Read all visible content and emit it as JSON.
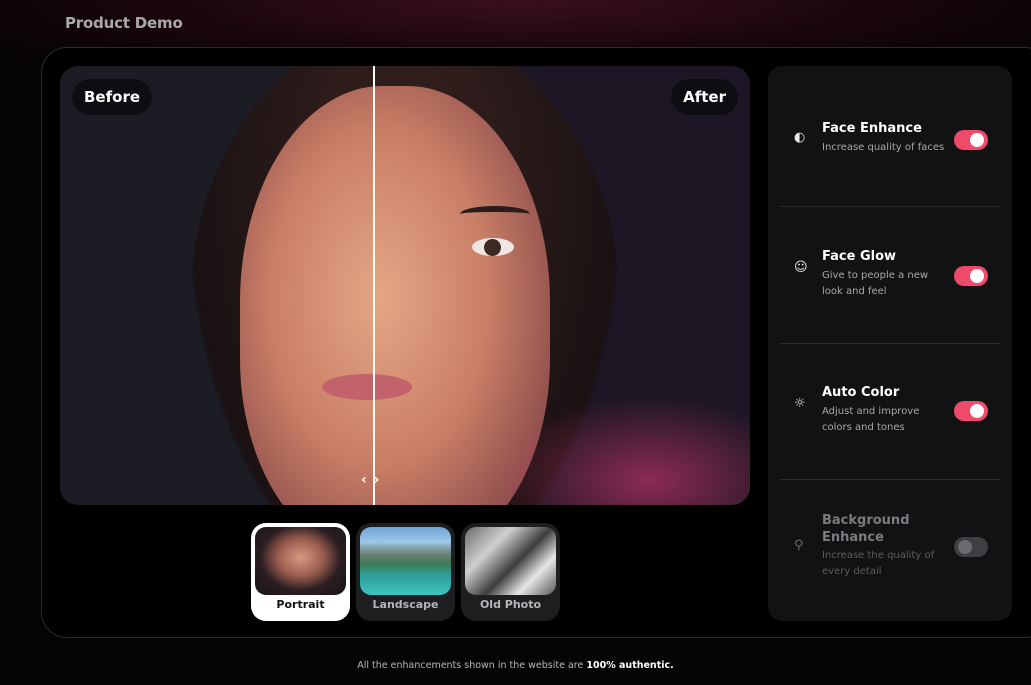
{
  "section_title": "Product Demo",
  "viewer": {
    "before_label": "Before",
    "after_label": "After",
    "handle_glyph": "‹ ›"
  },
  "samples": [
    {
      "label": "Portrait",
      "active": true
    },
    {
      "label": "Landscape",
      "active": false
    },
    {
      "label": "Old Photo",
      "active": false
    }
  ],
  "features": [
    {
      "title": "Face Enhance",
      "description": "Increase quality of faces",
      "icon": "face-enhance-icon",
      "enabled": true
    },
    {
      "title": "Face Glow",
      "description": "Give to people a new look and feel",
      "icon": "face-glow-icon",
      "enabled": true
    },
    {
      "title": "Auto Color",
      "description": "Adjust and improve colors and tones",
      "icon": "sun-icon",
      "enabled": true
    },
    {
      "title": "Background Enhance",
      "description": "Increase the quality of every detail",
      "icon": "background-icon",
      "enabled": false
    }
  ],
  "footer": {
    "text": "All the enhancements shown in the website are",
    "highlight": "100% authentic."
  },
  "colors": {
    "accent": "#f04a6a",
    "panel_bg": "#121214",
    "toggle_off": "#3f3f43"
  }
}
